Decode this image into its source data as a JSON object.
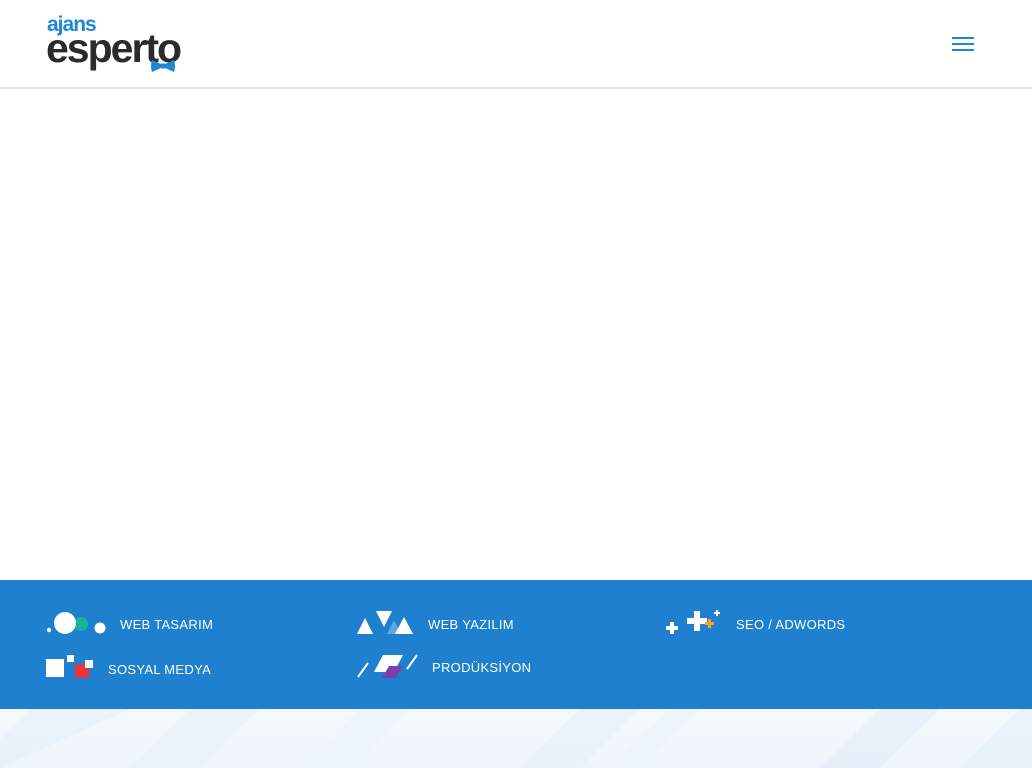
{
  "header": {
    "logo": {
      "small_text": "ajans",
      "big_text": "esperto"
    },
    "menu_icon": "hamburger-menu-icon"
  },
  "services": [
    {
      "label": "WEB TASARIM",
      "icon": "web-design-icon"
    },
    {
      "label": "WEB YAZILIM",
      "icon": "web-software-icon"
    },
    {
      "label": "SEO / ADWORDS",
      "icon": "seo-icon"
    },
    {
      "label": "SOSYAL MEDYA",
      "icon": "social-media-icon"
    },
    {
      "label": "PRODÜKSİYON",
      "icon": "production-icon"
    }
  ],
  "colors": {
    "brand_blue": "#1e80ce",
    "logo_blue": "#1e88d6",
    "logo_dark": "#2b2b2b",
    "accent_green": "#19b49b",
    "accent_orange": "#f5a623",
    "accent_red": "#e8343a",
    "accent_purple": "#7d3fae"
  }
}
